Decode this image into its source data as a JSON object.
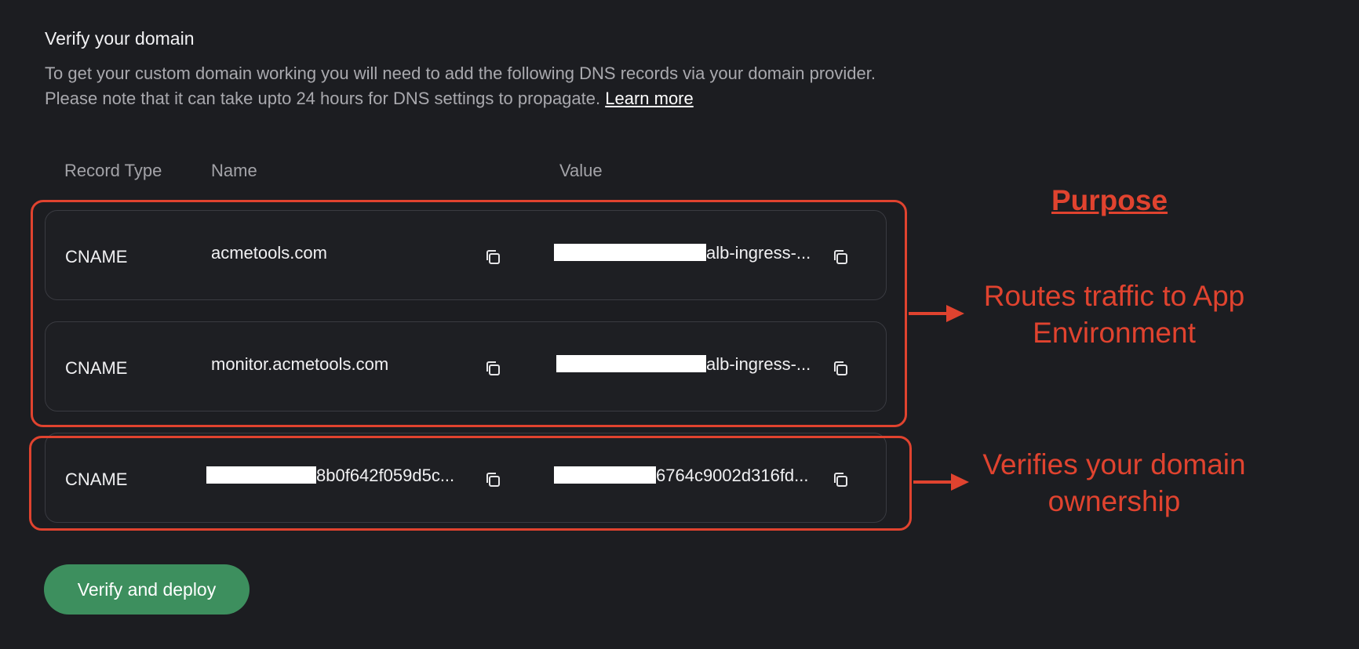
{
  "header": {
    "title": "Verify your domain",
    "description": "To get your custom domain working you will need to add the following DNS records via your domain provider. Please note that it can take upto 24 hours for DNS settings to propagate.",
    "learn_more": "Learn more"
  },
  "table": {
    "columns": [
      "Record Type",
      "Name",
      "Value"
    ],
    "rows": [
      {
        "type": "CNAME",
        "name": "acmetools.com",
        "value": "alb-ingress-..."
      },
      {
        "type": "CNAME",
        "name": "monitor.acmetools.com",
        "value": "alb-ingress-..."
      },
      {
        "type": "CNAME",
        "name": "8b0f642f059d5c...",
        "value": "6764c9002d316fd..."
      }
    ]
  },
  "annotations": {
    "purpose": "Purpose",
    "routes": "Routes traffic to App Environment",
    "verifies": "Verifies your domain ownership"
  },
  "actions": {
    "verify_deploy": "Verify and deploy"
  },
  "colors": {
    "background": "#1c1d21",
    "accent_red": "#e0432f",
    "button_green": "#3d8f5e"
  },
  "icons": {
    "copy": "copy-icon",
    "arrow": "arrow-right-icon"
  }
}
